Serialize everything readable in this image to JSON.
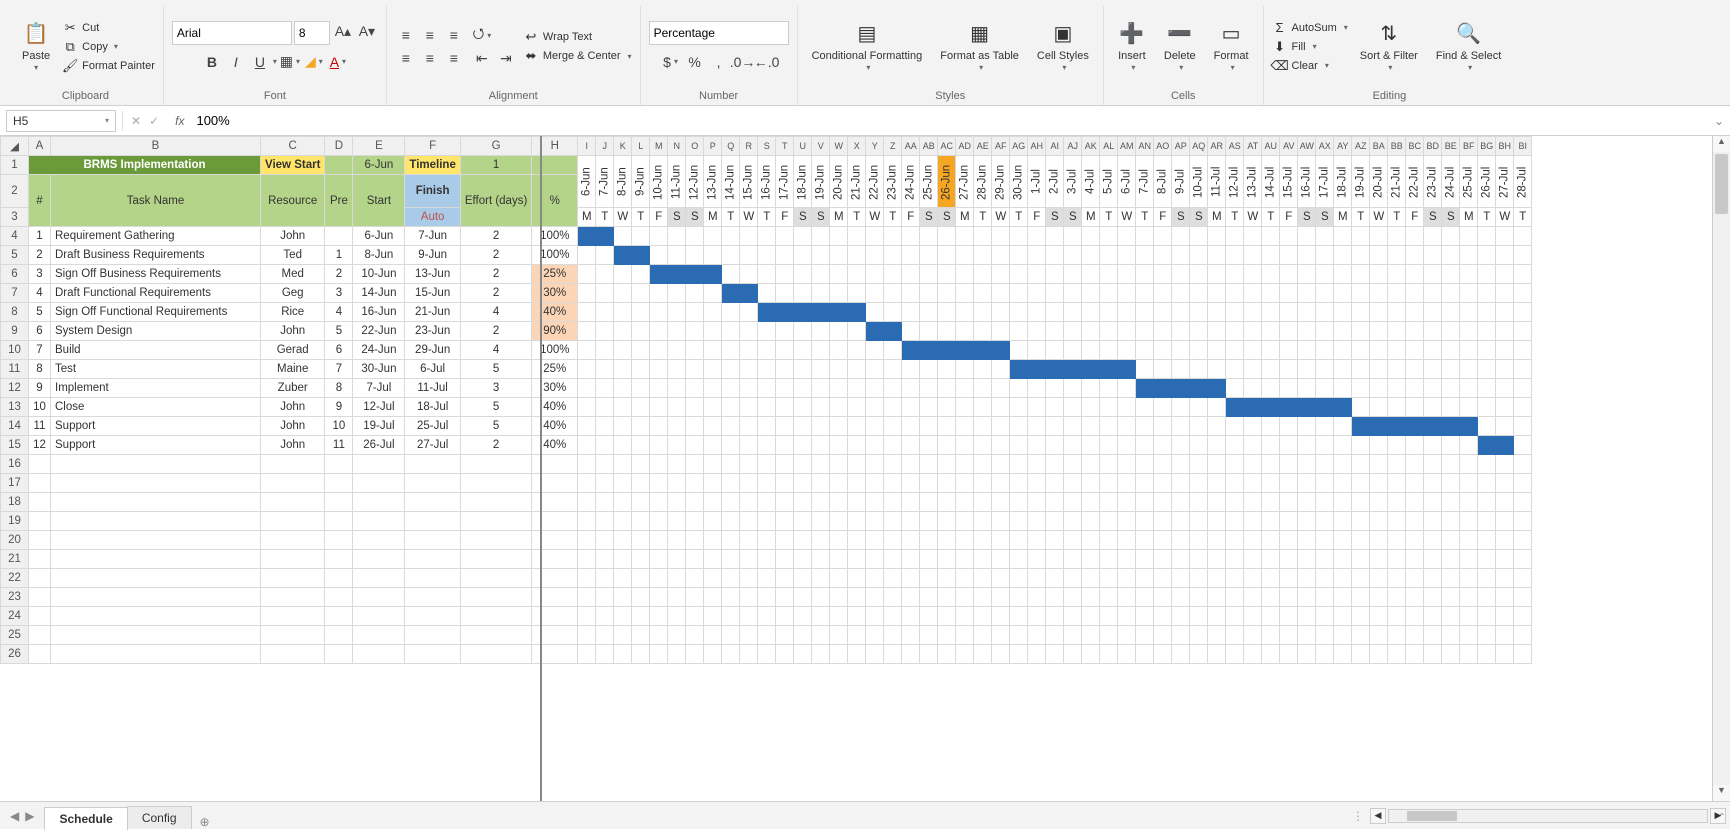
{
  "ribbon": {
    "clipboard": {
      "label": "Clipboard",
      "paste": "Paste",
      "cut": "Cut",
      "copy": "Copy",
      "format_painter": "Format Painter"
    },
    "font": {
      "label": "Font",
      "face": "Arial",
      "size": "8"
    },
    "alignment": {
      "label": "Alignment",
      "wrap": "Wrap Text",
      "merge": "Merge & Center"
    },
    "number": {
      "label": "Number",
      "format": "Percentage"
    },
    "styles": {
      "label": "Styles",
      "cond": "Conditional Formatting",
      "table": "Format as Table",
      "cell": "Cell Styles"
    },
    "cells": {
      "label": "Cells",
      "insert": "Insert",
      "delete": "Delete",
      "format": "Format"
    },
    "editing": {
      "label": "Editing",
      "autosum": "AutoSum",
      "fill": "Fill",
      "clear": "Clear",
      "sort": "Sort & Filter",
      "find": "Find & Select"
    }
  },
  "formula_bar": {
    "cell_ref": "H5",
    "value": "100%"
  },
  "title_cells": {
    "project": "BRMS Implementation",
    "view_start": "View Start",
    "view_start_date": "6-Jun",
    "timeline": "Timeline",
    "timeline_val": "1"
  },
  "headers": {
    "num": "#",
    "task": "Task Name",
    "resource": "Resource",
    "pre": "Pre",
    "start": "Start",
    "finish": "Finish",
    "finish_sub": "Auto",
    "effort": "Effort (days)",
    "pct": "%"
  },
  "today_index": 20,
  "dates": [
    "6-Jun",
    "7-Jun",
    "8-Jun",
    "9-Jun",
    "10-Jun",
    "11-Jun",
    "12-Jun",
    "13-Jun",
    "14-Jun",
    "15-Jun",
    "16-Jun",
    "17-Jun",
    "18-Jun",
    "19-Jun",
    "20-Jun",
    "21-Jun",
    "22-Jun",
    "23-Jun",
    "24-Jun",
    "25-Jun",
    "26-Jun",
    "27-Jun",
    "28-Jun",
    "29-Jun",
    "30-Jun",
    "1-Jul",
    "2-Jul",
    "3-Jul",
    "4-Jul",
    "5-Jul",
    "6-Jul",
    "7-Jul",
    "8-Jul",
    "9-Jul",
    "10-Jul",
    "11-Jul",
    "12-Jul",
    "13-Jul",
    "14-Jul",
    "15-Jul",
    "16-Jul",
    "17-Jul",
    "18-Jul",
    "19-Jul",
    "20-Jul",
    "21-Jul",
    "22-Jul",
    "23-Jul",
    "24-Jul",
    "25-Jul",
    "26-Jul",
    "27-Jul",
    "28-Jul"
  ],
  "dow": [
    "M",
    "T",
    "W",
    "T",
    "F",
    "S",
    "S",
    "M",
    "T",
    "W",
    "T",
    "F",
    "S",
    "S",
    "M",
    "T",
    "W",
    "T",
    "F",
    "S",
    "S",
    "M",
    "T",
    "W",
    "T",
    "F",
    "S",
    "S",
    "M",
    "T",
    "W",
    "T",
    "F",
    "S",
    "S",
    "M",
    "T",
    "W",
    "T",
    "F",
    "S",
    "S",
    "M",
    "T",
    "W",
    "T",
    "F",
    "S",
    "S",
    "M",
    "T",
    "W",
    "T"
  ],
  "tasks": [
    {
      "n": 1,
      "name": "Requirement Gathering",
      "res": "John",
      "pre": "",
      "start": "6-Jun",
      "finish": "7-Jun",
      "effort": 2,
      "pct": "100%",
      "pct_hl": false,
      "bar_s": 0,
      "bar_e": 1
    },
    {
      "n": 2,
      "name": "Draft Business Requirements",
      "res": "Ted",
      "pre": "1",
      "start": "8-Jun",
      "finish": "9-Jun",
      "effort": 2,
      "pct": "100%",
      "pct_hl": false,
      "bar_s": 2,
      "bar_e": 3
    },
    {
      "n": 3,
      "name": "Sign Off Business Requirements",
      "res": "Med",
      "pre": "2",
      "start": "10-Jun",
      "finish": "13-Jun",
      "effort": 2,
      "pct": "25%",
      "pct_hl": true,
      "bar_s": 4,
      "bar_e": 7
    },
    {
      "n": 4,
      "name": "Draft Functional Requirements",
      "res": "Geg",
      "pre": "3",
      "start": "14-Jun",
      "finish": "15-Jun",
      "effort": 2,
      "pct": "30%",
      "pct_hl": true,
      "bar_s": 8,
      "bar_e": 9
    },
    {
      "n": 5,
      "name": "Sign Off Functional Requirements",
      "res": "Rice",
      "pre": "4",
      "start": "16-Jun",
      "finish": "21-Jun",
      "effort": 4,
      "pct": "40%",
      "pct_hl": true,
      "bar_s": 10,
      "bar_e": 15
    },
    {
      "n": 6,
      "name": "System Design",
      "res": "John",
      "pre": "5",
      "start": "22-Jun",
      "finish": "23-Jun",
      "effort": 2,
      "pct": "90%",
      "pct_hl": true,
      "bar_s": 16,
      "bar_e": 17
    },
    {
      "n": 7,
      "name": "Build",
      "res": "Gerad",
      "pre": "6",
      "start": "24-Jun",
      "finish": "29-Jun",
      "effort": 4,
      "pct": "100%",
      "pct_hl": false,
      "bar_s": 18,
      "bar_e": 23
    },
    {
      "n": 8,
      "name": "Test",
      "res": "Maine",
      "pre": "7",
      "start": "30-Jun",
      "finish": "6-Jul",
      "effort": 5,
      "pct": "25%",
      "pct_hl": false,
      "bar_s": 24,
      "bar_e": 30
    },
    {
      "n": 9,
      "name": "Implement",
      "res": "Zuber",
      "pre": "8",
      "start": "7-Jul",
      "finish": "11-Jul",
      "effort": 3,
      "pct": "30%",
      "pct_hl": false,
      "bar_s": 31,
      "bar_e": 35
    },
    {
      "n": 10,
      "name": "Close",
      "res": "John",
      "pre": "9",
      "start": "12-Jul",
      "finish": "18-Jul",
      "effort": 5,
      "pct": "40%",
      "pct_hl": false,
      "bar_s": 36,
      "bar_e": 42
    },
    {
      "n": 11,
      "name": "Support",
      "res": "John",
      "pre": "10",
      "start": "19-Jul",
      "finish": "25-Jul",
      "effort": 5,
      "pct": "40%",
      "pct_hl": false,
      "bar_s": 43,
      "bar_e": 49
    },
    {
      "n": 12,
      "name": "Support",
      "res": "John",
      "pre": "11",
      "start": "26-Jul",
      "finish": "27-Jul",
      "effort": 2,
      "pct": "40%",
      "pct_hl": false,
      "bar_s": 50,
      "bar_e": 51
    }
  ],
  "empty_rows_start": 16,
  "empty_rows_end": 26,
  "tabs": {
    "active": "Schedule",
    "other": "Config"
  },
  "col_letters_fixed": [
    "A",
    "B",
    "C",
    "D",
    "E",
    "F",
    "G",
    "H"
  ],
  "col_letters_gantt": [
    "I",
    "J",
    "K",
    "L",
    "M",
    "N",
    "O",
    "P",
    "Q",
    "R",
    "S",
    "T",
    "U",
    "V",
    "W",
    "X",
    "Y",
    "Z",
    "AA",
    "AB",
    "AC",
    "AD",
    "AE",
    "AF",
    "AG",
    "AH",
    "AI",
    "AJ",
    "AK",
    "AL",
    "AM",
    "AN",
    "AO",
    "AP",
    "AQ",
    "AR",
    "AS",
    "AT",
    "AU",
    "AV",
    "AW",
    "AX",
    "AY",
    "AZ",
    "BA",
    "BB",
    "BC",
    "BD",
    "BE",
    "BF",
    "BG",
    "BH",
    "BI"
  ],
  "chart_data": {
    "type": "gantt",
    "title": "BRMS Implementation",
    "x_start": "6-Jun",
    "x_end": "28-Jul",
    "tasks": [
      {
        "name": "Requirement Gathering",
        "start": "6-Jun",
        "finish": "7-Jun",
        "pct": 100
      },
      {
        "name": "Draft Business Requirements",
        "start": "8-Jun",
        "finish": "9-Jun",
        "pct": 100
      },
      {
        "name": "Sign Off Business Requirements",
        "start": "10-Jun",
        "finish": "13-Jun",
        "pct": 25
      },
      {
        "name": "Draft Functional Requirements",
        "start": "14-Jun",
        "finish": "15-Jun",
        "pct": 30
      },
      {
        "name": "Sign Off Functional Requirements",
        "start": "16-Jun",
        "finish": "21-Jun",
        "pct": 40
      },
      {
        "name": "System Design",
        "start": "22-Jun",
        "finish": "23-Jun",
        "pct": 90
      },
      {
        "name": "Build",
        "start": "24-Jun",
        "finish": "29-Jun",
        "pct": 100
      },
      {
        "name": "Test",
        "start": "30-Jun",
        "finish": "6-Jul",
        "pct": 25
      },
      {
        "name": "Implement",
        "start": "7-Jul",
        "finish": "11-Jul",
        "pct": 30
      },
      {
        "name": "Close",
        "start": "12-Jul",
        "finish": "18-Jul",
        "pct": 40
      },
      {
        "name": "Support",
        "start": "19-Jul",
        "finish": "25-Jul",
        "pct": 40
      },
      {
        "name": "Support",
        "start": "26-Jul",
        "finish": "27-Jul",
        "pct": 40
      }
    ]
  }
}
